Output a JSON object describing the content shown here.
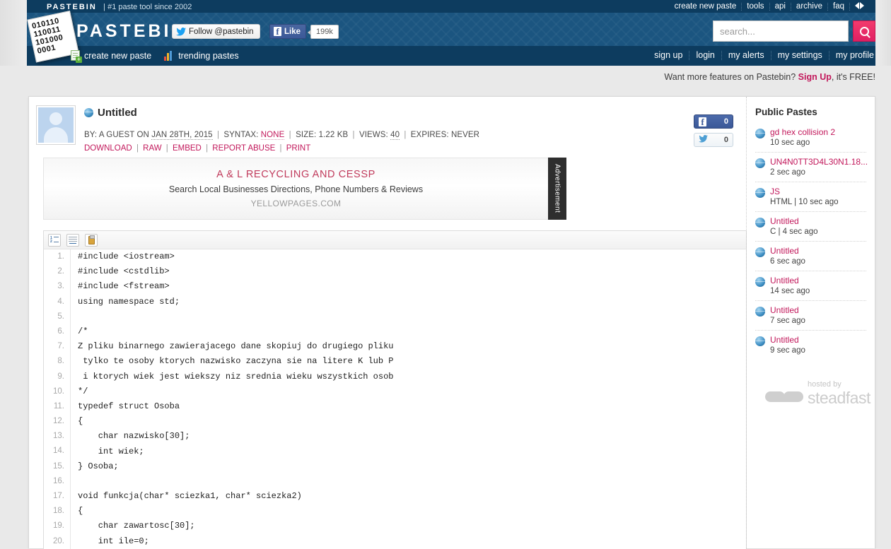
{
  "header": {
    "brand_small": "PASTEBIN",
    "tagline": "| #1 paste tool since 2002",
    "brand_big": "PASTEBIN",
    "logo_lines": [
      "010110",
      "110011",
      "101000",
      "0001"
    ],
    "top_nav": [
      {
        "label": "create new paste"
      },
      {
        "label": "tools"
      },
      {
        "label": "api"
      },
      {
        "label": "archive"
      },
      {
        "label": "faq"
      }
    ],
    "twitter_follow": "Follow @pastebin",
    "facebook_like": "Like",
    "facebook_count": "199k",
    "search": {
      "placeholder": "search...",
      "value": ""
    },
    "sub_nav_left": [
      {
        "label": "create new paste",
        "icon": "new-paste-icon"
      },
      {
        "label": "trending pastes",
        "icon": "trending-icon"
      }
    ],
    "sub_nav_right": [
      {
        "label": "sign up"
      },
      {
        "label": "login"
      },
      {
        "label": "my alerts"
      },
      {
        "label": "my settings"
      },
      {
        "label": "my profile"
      }
    ]
  },
  "signup_strip": {
    "text_before": "Want more features on Pastebin? ",
    "link": "Sign Up",
    "text_after": ", it's FREE!"
  },
  "paste": {
    "title": "Untitled",
    "by_label": "BY:",
    "author": "A GUEST",
    "on_label": "ON",
    "date": "JAN 28TH, 2015",
    "syntax_label": "SYNTAX:",
    "syntax": "NONE",
    "size_label": "SIZE:",
    "size": "1.22 KB",
    "views_label": "VIEWS:",
    "views": "40",
    "expires_label": "EXPIRES:",
    "expires": "NEVER",
    "actions": [
      {
        "label": "DOWNLOAD"
      },
      {
        "label": "RAW"
      },
      {
        "label": "EMBED"
      },
      {
        "label": "REPORT ABUSE"
      },
      {
        "label": "PRINT"
      }
    ],
    "social": {
      "facebook_count": "0",
      "twitter_count": "0"
    }
  },
  "advertisement": {
    "title": "A & L RECYCLING AND CESSP",
    "description": "Search Local Businesses Directions, Phone Numbers & Reviews",
    "url": "YELLOWPAGES.COM",
    "tab_label": "Advertisement"
  },
  "code_toolbar": [
    {
      "name": "toggle-line-numbers",
      "icon": "line-numbers-icon"
    },
    {
      "name": "toggle-word-wrap",
      "icon": "word-wrap-icon"
    },
    {
      "name": "copy-to-clipboard",
      "icon": "clipboard-icon"
    }
  ],
  "code": {
    "lines": [
      "#include <iostream>",
      "#include <cstdlib>",
      "#include <fstream>",
      "using namespace std;",
      "",
      "/*",
      "Z pliku binarnego zawierajacego dane skopiuj do drugiego pliku",
      " tylko te osoby ktorych nazwisko zaczyna sie na litere K lub P",
      " i ktorych wiek jest wiekszy niz srednia wieku wszystkich osob",
      "*/",
      "typedef struct Osoba",
      "{",
      "    char nazwisko[30];",
      "    int wiek;",
      "} Osoba;",
      "",
      "void funkcja(char* sciezka1, char* sciezka2)",
      "{",
      "    char zawartosc[30];",
      "    int ile=0;"
    ]
  },
  "sidebar": {
    "title": "Public Pastes",
    "items": [
      {
        "name": "gd hex collision 2",
        "sub": "10 sec ago"
      },
      {
        "name": "UN4N0TT3D4L30N1.18...",
        "sub": "2 sec ago"
      },
      {
        "name": "JS",
        "sub": "HTML | 10 sec ago"
      },
      {
        "name": "Untitled",
        "sub": "C | 4 sec ago"
      },
      {
        "name": "Untitled",
        "sub": "6 sec ago"
      },
      {
        "name": "Untitled",
        "sub": "14 sec ago"
      },
      {
        "name": "Untitled",
        "sub": "7 sec ago"
      },
      {
        "name": "Untitled",
        "sub": "9 sec ago"
      }
    ],
    "hosted_by": "hosted by",
    "host_name": "steadfast"
  },
  "colors": {
    "accent_pink": "#c2185b",
    "header_dark": "#0d3c5f",
    "header_mid": "#1b5580",
    "search_button": "#e02063"
  }
}
